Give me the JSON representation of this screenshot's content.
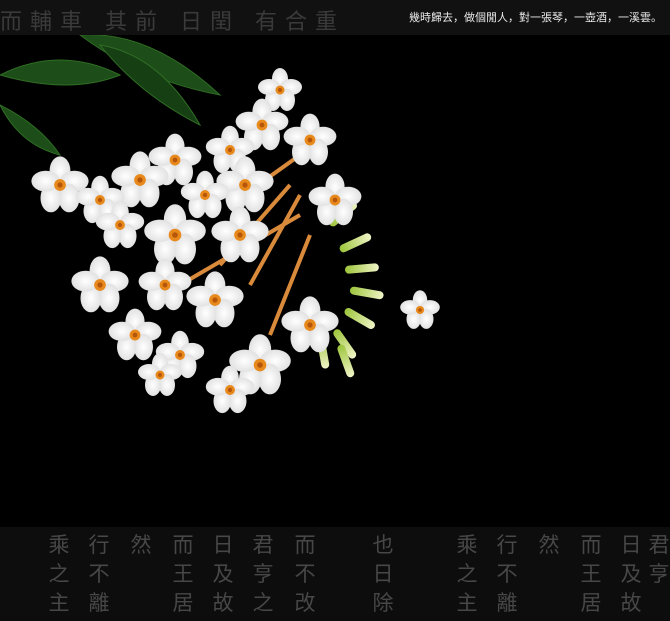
{
  "caption": "幾時歸去，做個閒人，對一張琴，一壺酒，一溪雲。",
  "background_calligraphy_top": "而輔車 其前 日閏 有合重",
  "bottom_columns": [
    "乘之主",
    "行不離",
    "然",
    "而王居",
    "日及故",
    "君亨之",
    "而不改",
    "也日除",
    "乘之主",
    "行不離",
    "然",
    "而王居",
    "日及故",
    "君亨"
  ],
  "colors": {
    "background": "#000000",
    "petal": "#ffffff",
    "center": "#e8891c",
    "bud": "#c8e06a",
    "leaf": "#1f5a1a"
  }
}
